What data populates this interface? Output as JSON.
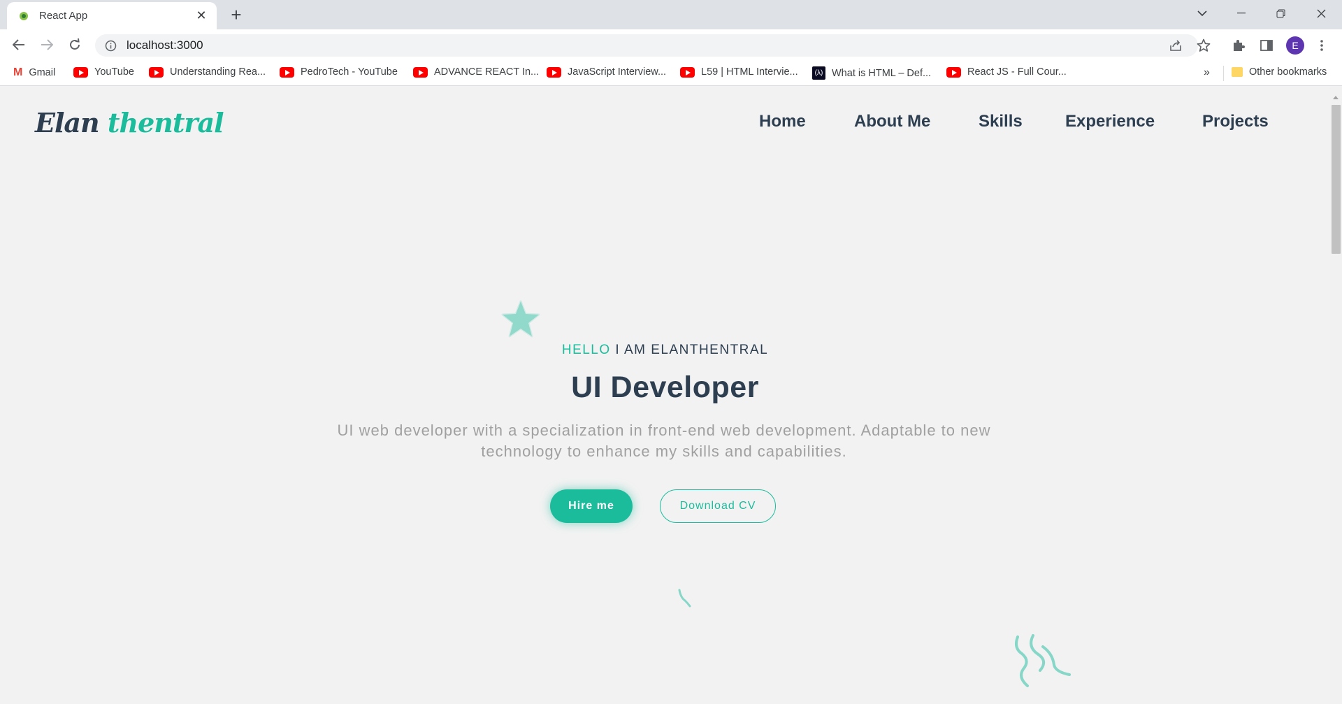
{
  "browser": {
    "tab_title": "React App",
    "url": "localhost:3000",
    "profile_initial": "E",
    "accent": "#5e35b1"
  },
  "bookmarks": [
    {
      "label": "Gmail",
      "icon": "gmail-icon"
    },
    {
      "label": "YouTube",
      "icon": "youtube-icon"
    },
    {
      "label": "Understanding Rea...",
      "icon": "youtube-icon"
    },
    {
      "label": "PedroTech - YouTube",
      "icon": "youtube-icon"
    },
    {
      "label": "ADVANCE REACT In...",
      "icon": "youtube-icon"
    },
    {
      "label": "JavaScript Interview...",
      "icon": "youtube-icon"
    },
    {
      "label": "L59 | HTML Intervie...",
      "icon": "youtube-icon"
    },
    {
      "label": "What is HTML – Def...",
      "icon": "freecodecamp-icon"
    },
    {
      "label": "React JS - Full Cour...",
      "icon": "youtube-icon"
    }
  ],
  "bookmarks_overflow": "»",
  "other_bookmarks": "Other bookmarks",
  "site": {
    "logo_part1": "Elan",
    "logo_part2": "thentral",
    "nav": [
      "Home",
      "About Me",
      "Skills",
      "Experience",
      "Projects"
    ],
    "hero": {
      "kicker_highlight": "HELLO",
      "kicker_rest": " I AM ELANTHENTRAL",
      "title": "UI Developer",
      "description": "UI web developer with a specialization in front-end web development. Adaptable to new technology to enhance my skills and capabilities.",
      "hire_label": "Hire me",
      "cv_label": "Download CV"
    },
    "colors": {
      "primary": "#1abc9c",
      "dark": "#2c3e50",
      "muted": "#a0a0a0",
      "background": "#f2f2f2"
    }
  }
}
